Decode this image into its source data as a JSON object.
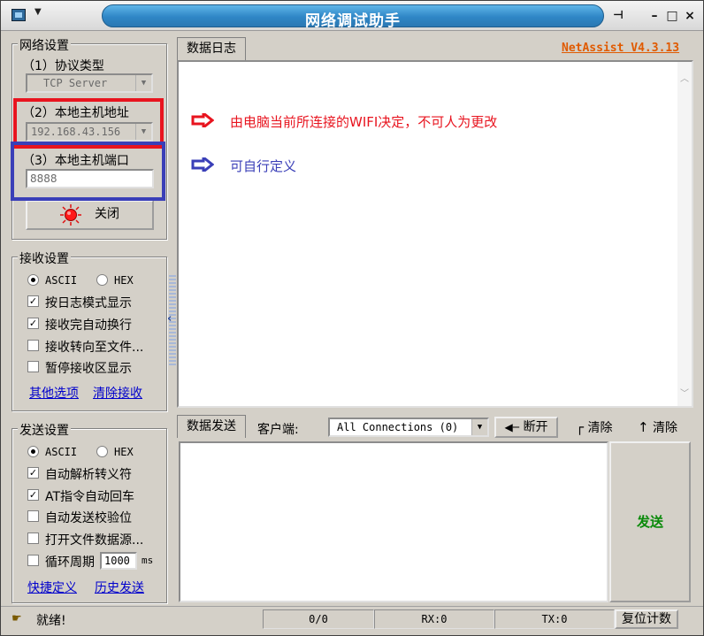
{
  "window": {
    "title": "网络调试助手",
    "version_label": "NetAssist V4.3.13",
    "controls": {
      "pin": "⊣",
      "minimize": "–",
      "maximize": "□",
      "close": "×"
    }
  },
  "network_settings": {
    "legend": "网络设置",
    "protocol_label": "（1）协议类型",
    "protocol_value": "TCP Server",
    "host_label": "（2）本地主机地址",
    "host_value": "192.168.43.156",
    "port_label": "（3）本地主机端口",
    "port_value": "8888",
    "close_button": "关闭"
  },
  "receive_settings": {
    "legend": "接收设置",
    "encoding_options": [
      "ASCII",
      "HEX"
    ],
    "encoding_selected": "ASCII",
    "options": [
      {
        "label": "按日志模式显示",
        "checked": true
      },
      {
        "label": "接收完自动换行",
        "checked": true
      },
      {
        "label": "接收转向至文件...",
        "checked": false
      },
      {
        "label": "暂停接收区显示",
        "checked": false
      }
    ],
    "links": [
      "其他选项",
      "清除接收"
    ]
  },
  "send_settings": {
    "legend": "发送设置",
    "encoding_options": [
      "ASCII",
      "HEX"
    ],
    "encoding_selected": "ASCII",
    "options": [
      {
        "label": "自动解析转义符",
        "checked": true
      },
      {
        "label": "AT指令自动回车",
        "checked": true
      },
      {
        "label": "自动发送校验位",
        "checked": false
      },
      {
        "label": "打开文件数据源...",
        "checked": false
      },
      {
        "label": "循环周期",
        "checked": false
      }
    ],
    "cycle_value": "1000",
    "cycle_unit": "ms",
    "links": [
      "快捷定义",
      "历史发送"
    ]
  },
  "log": {
    "tab_label": "数据日志",
    "annotation_red": "由电脑当前所连接的WIFI决定，不可人为更改",
    "annotation_blue": "可自行定义"
  },
  "send": {
    "tab_label": "数据发送",
    "client_label": "客户端:",
    "client_value": "All Connections (0)",
    "disconnect_button": "断开",
    "clear_button_1": "清除",
    "clear_button_2": "清除",
    "send_button": "发送"
  },
  "statusbar": {
    "status_text": "就绪!",
    "count": "0/0",
    "rx": "RX:0",
    "tx": "TX:0",
    "reset_button": "复位计数"
  },
  "colors": {
    "title_blue": "#2f86c6",
    "version_orange": "#e05a00",
    "annotation_red": "#e8141f",
    "annotation_blue": "#3a3fb8",
    "send_green": "#0a8a0a"
  }
}
